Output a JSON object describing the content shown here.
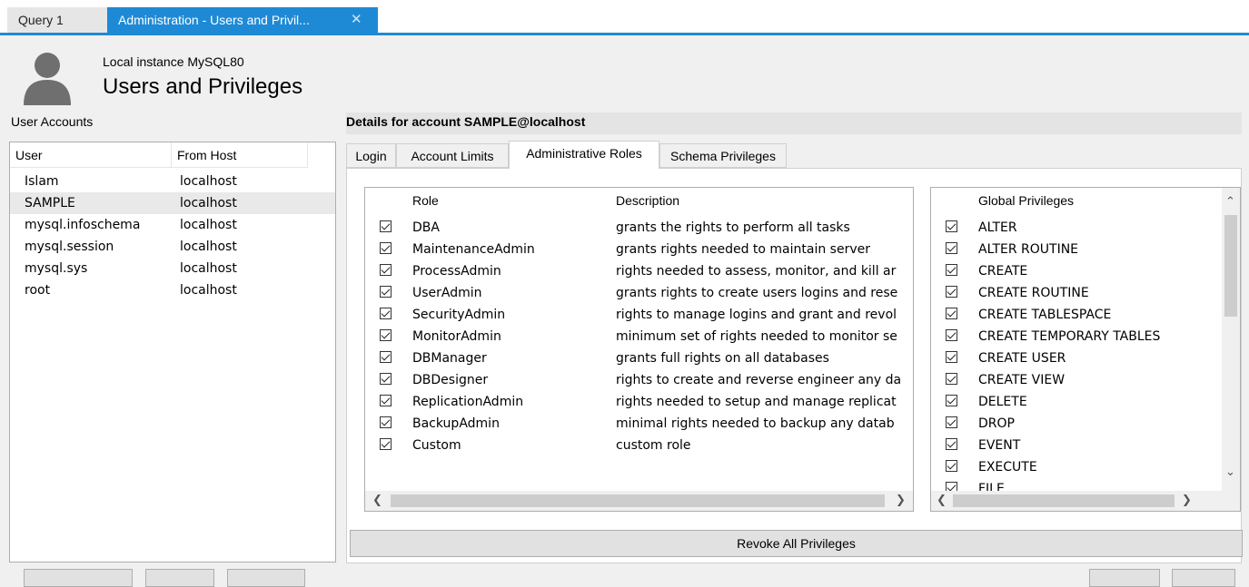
{
  "tabs": [
    {
      "label": "Query 1"
    },
    {
      "label": "Administration - Users and Privil..."
    }
  ],
  "header": {
    "instance": "Local instance MySQL80",
    "title": "Users and Privileges"
  },
  "accounts": {
    "title": "User Accounts",
    "columns": [
      "User",
      "From Host"
    ],
    "rows": [
      {
        "user": "Islam",
        "host": "localhost"
      },
      {
        "user": "SAMPLE",
        "host": "localhost"
      },
      {
        "user": "mysql.infoschema",
        "host": "localhost"
      },
      {
        "user": "mysql.session",
        "host": "localhost"
      },
      {
        "user": "mysql.sys",
        "host": "localhost"
      },
      {
        "user": "root",
        "host": "localhost"
      }
    ],
    "selected_user": "SAMPLE"
  },
  "details": {
    "title": "Details for account SAMPLE@localhost",
    "tabs": [
      "Login",
      "Account Limits",
      "Administrative Roles",
      "Schema Privileges"
    ],
    "active_tab": "Administrative Roles",
    "roles_columns": [
      "Role",
      "Description"
    ],
    "roles": [
      {
        "role": "DBA",
        "description": "grants the rights to perform all tasks",
        "checked": true
      },
      {
        "role": "MaintenanceAdmin",
        "description": "grants rights needed to maintain server",
        "checked": true
      },
      {
        "role": "ProcessAdmin",
        "description": "rights needed to assess, monitor, and kill ar",
        "checked": true
      },
      {
        "role": "UserAdmin",
        "description": "grants rights to create users logins and rese",
        "checked": true
      },
      {
        "role": "SecurityAdmin",
        "description": "rights to manage logins and grant and revol",
        "checked": true
      },
      {
        "role": "MonitorAdmin",
        "description": "minimum set of rights needed to monitor se",
        "checked": true
      },
      {
        "role": "DBManager",
        "description": "grants full rights on all databases",
        "checked": true
      },
      {
        "role": "DBDesigner",
        "description": "rights to create and reverse engineer any da",
        "checked": true
      },
      {
        "role": "ReplicationAdmin",
        "description": "rights needed to setup and manage replicat",
        "checked": true
      },
      {
        "role": "BackupAdmin",
        "description": "minimal rights needed to backup any datab",
        "checked": true
      },
      {
        "role": "Custom",
        "description": "custom role",
        "checked": true
      }
    ],
    "privileges_column": "Global Privileges",
    "privileges": [
      "ALTER",
      "ALTER ROUTINE",
      "CREATE",
      "CREATE ROUTINE",
      "CREATE TABLESPACE",
      "CREATE TEMPORARY TABLES",
      "CREATE USER",
      "CREATE VIEW",
      "DELETE",
      "DROP",
      "EVENT",
      "EXECUTE",
      "FILE"
    ],
    "revoke_label": "Revoke All Privileges"
  },
  "icons": {
    "user_avatar": "user-silhouette-icon",
    "close": "close-icon",
    "scroll_left": "chevron-left-icon",
    "scroll_right": "chevron-right-icon",
    "scroll_up": "chevron-up-icon",
    "scroll_down": "chevron-down-icon",
    "checkbox": "checkbox-checked-icon"
  },
  "colors": {
    "accent": "#1e8ad6"
  }
}
